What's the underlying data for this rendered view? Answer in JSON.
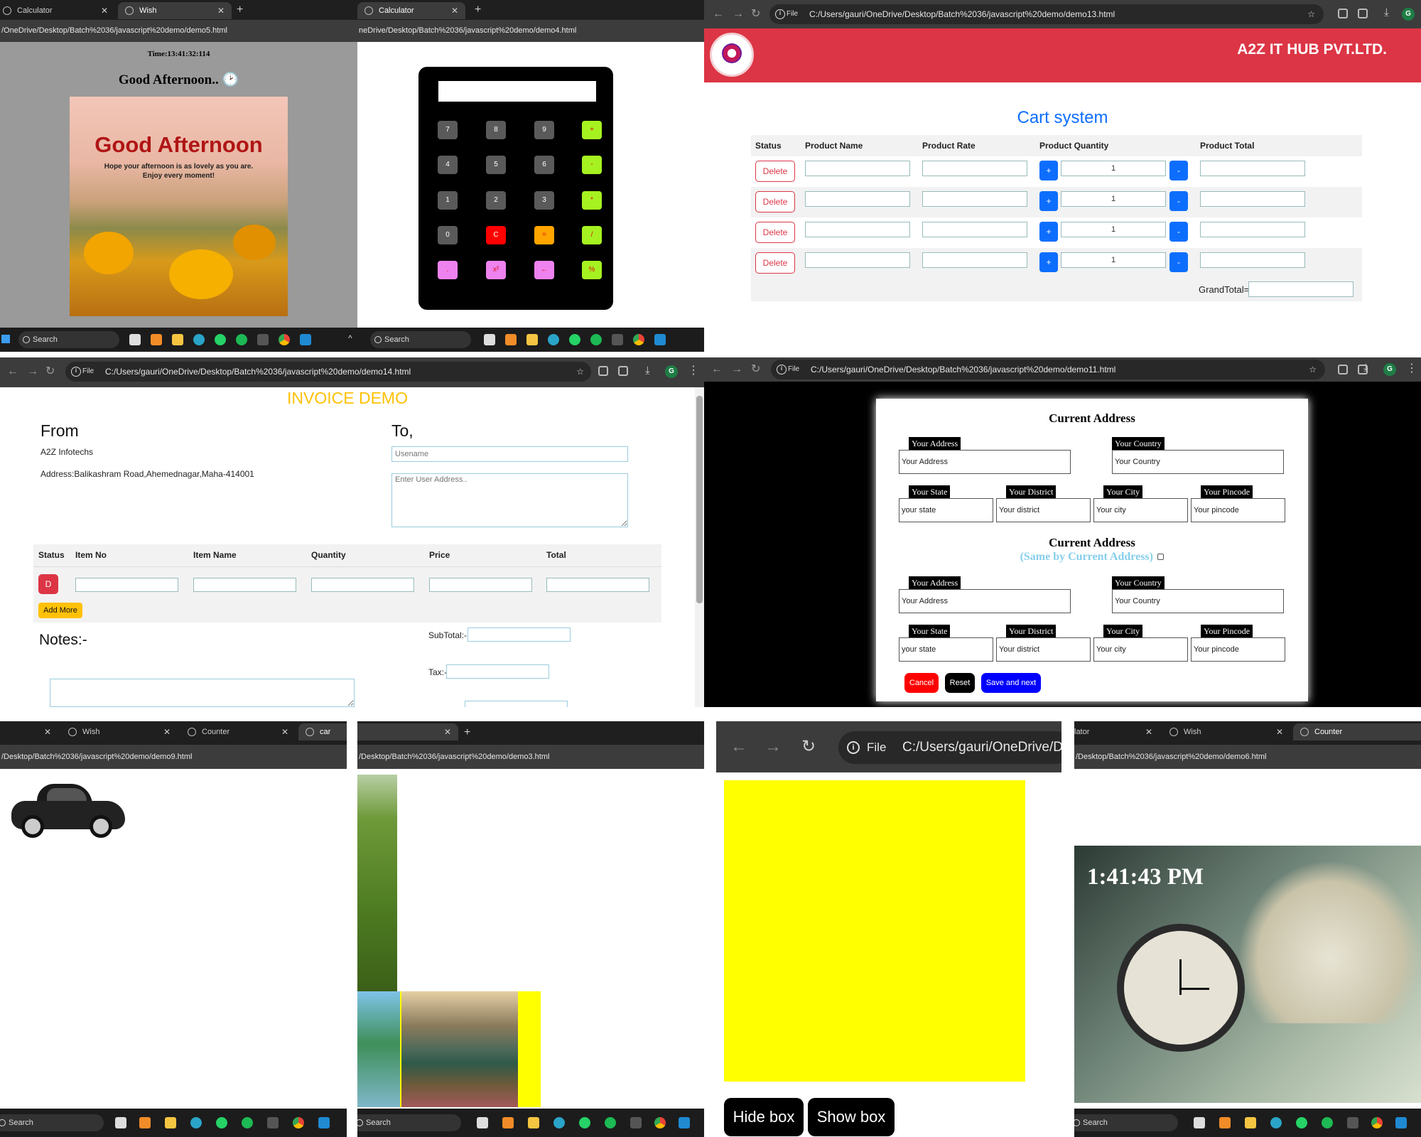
{
  "wish": {
    "tabs": [
      "Calculator",
      "Wish"
    ],
    "url": "/OneDrive/Desktop/Batch%2036/javascript%20demo/demo5.html",
    "time": "Time:13:41:32:114",
    "greeting": "Good Afternoon..",
    "card_title": "Good Afternoon",
    "card_line1": "Hope your afternoon is as lovely as you are.",
    "card_line2": "Enjoy every moment!"
  },
  "calc": {
    "tab": "Calculator",
    "url": "neDrive/Desktop/Batch%2036/javascript%20demo/demo4.html",
    "buttons": [
      {
        "label": "7",
        "color": "#5a5a5a"
      },
      {
        "label": "8",
        "color": "#5a5a5a"
      },
      {
        "label": "9",
        "color": "#5a5a5a"
      },
      {
        "label": "+",
        "color": "#a6f221"
      },
      {
        "label": "4",
        "color": "#5a5a5a"
      },
      {
        "label": "5",
        "color": "#5a5a5a"
      },
      {
        "label": "6",
        "color": "#5a5a5a"
      },
      {
        "label": "-",
        "color": "#a6f221"
      },
      {
        "label": "1",
        "color": "#5a5a5a"
      },
      {
        "label": "2",
        "color": "#5a5a5a"
      },
      {
        "label": "3",
        "color": "#5a5a5a"
      },
      {
        "label": "*",
        "color": "#a6f221"
      },
      {
        "label": "0",
        "color": "#5a5a5a"
      },
      {
        "label": "C",
        "color": "#ff0000"
      },
      {
        "label": "=",
        "color": "#ffa500"
      },
      {
        "label": "/",
        "color": "#a6f221"
      },
      {
        "label": ".",
        "color": "#ee82ee"
      },
      {
        "label": "x²",
        "color": "#ee82ee"
      },
      {
        "label": "←",
        "color": "#ee82ee"
      },
      {
        "label": "%",
        "color": "#a6f221"
      }
    ]
  },
  "cart": {
    "url": "C:/Users/gauri/OneDrive/Desktop/Batch%2036/javascript%20demo/demo13.html",
    "brand": "A2Z IT HUB PVT.LTD.",
    "title": "Cart system",
    "headers": [
      "Status",
      "Product Name",
      "Product Rate",
      "Product Quantity",
      "Product Total"
    ],
    "delete_label": "Delete",
    "plus": "+",
    "minus": "-",
    "qty": "1",
    "grand_total": "GrandTotal="
  },
  "invoice": {
    "url": "C:/Users/gauri/OneDrive/Desktop/Batch%2036/javascript%20demo/demo14.html",
    "title": "INVOICE DEMO",
    "from": "From",
    "company": "A2Z Infotechs",
    "address": "Address:Balikashram Road,Ahemednagar,Maha-414001",
    "to": "To,",
    "username_ph": "Usename",
    "address_ph": "Enter User Address..",
    "headers": [
      "Status",
      "Item No",
      "Item Name",
      "Quantity",
      "Price",
      "Total"
    ],
    "row_btn": "D",
    "add_more": "Add More",
    "notes": "Notes:-",
    "subtotal": "SubTotal:-",
    "tax": "Tax:-"
  },
  "address": {
    "url": "C:/Users/gauri/OneDrive/Desktop/Batch%2036/javascript%20demo/demo11.html",
    "heading1": "Current Address",
    "heading2": "Current Address",
    "same_by": "(Same by Current Address)",
    "lab_address": "Your Address",
    "lab_country": "Your Country",
    "lab_state": "Your State",
    "lab_district": "Your District",
    "lab_city": "Your City",
    "lab_pincode": "Your Pincode",
    "ph_address": "Your Address",
    "ph_country": "Your Country",
    "ph_state": "your state",
    "ph_district": "Your district",
    "ph_city": "Your city",
    "ph_pincode": "Your pincode",
    "cancel": "Cancel",
    "reset": "Reset",
    "save": "Save and next"
  },
  "car": {
    "tabs": [
      "Wish",
      "Counter",
      "car"
    ],
    "url": "/Desktop/Batch%2036/javascript%20demo/demo9.html"
  },
  "images": {
    "url": "/Desktop/Batch%2036/javascript%20demo/demo3.html"
  },
  "box": {
    "file": "File",
    "url": "C:/Users/gauri/OneDrive/D",
    "hide": "Hide box",
    "show": "Show box"
  },
  "clock": {
    "tabs": [
      "lator",
      "Wish",
      "Counter"
    ],
    "url": "/Desktop/Batch%2036/javascript%20demo/demo6.html",
    "time": "1:41:43 PM"
  },
  "taskbar": {
    "search": "Search"
  },
  "colors": {
    "cart_brand_bg": "#dc3545",
    "cart_title": "#0d6efd",
    "invoice_title": "#ffc107",
    "box_yellow": "#ffff00"
  }
}
